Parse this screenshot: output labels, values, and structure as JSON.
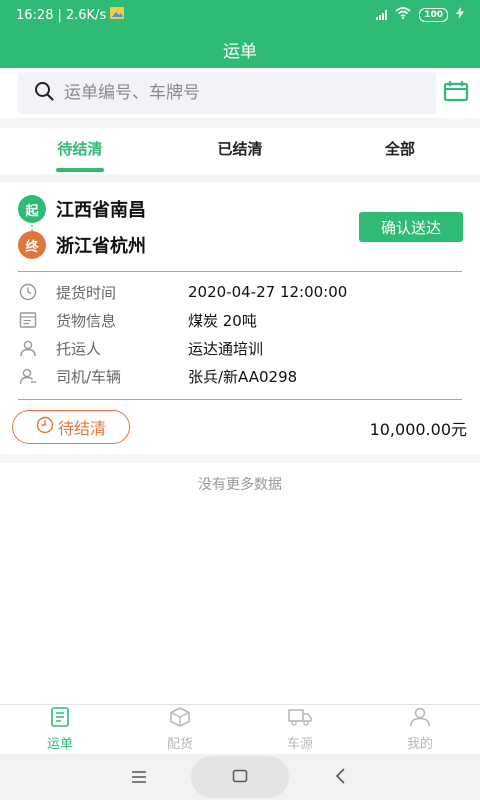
{
  "status_bar": {
    "time": "16:28",
    "speed": "2.6K/s",
    "battery": "100"
  },
  "header": {
    "title": "运单"
  },
  "search": {
    "placeholder": "运单编号、车牌号"
  },
  "tabs": [
    {
      "label": "待结清",
      "active": true
    },
    {
      "label": "已结清",
      "active": false
    },
    {
      "label": "全部",
      "active": false
    }
  ],
  "order": {
    "origin_badge": "起",
    "origin": "江西省南昌",
    "dest_badge": "终",
    "destination": "浙江省杭州",
    "confirm_label": "确认送达",
    "fields": [
      {
        "icon": "clock-icon",
        "label": "提货时间",
        "value": "2020-04-27 12:00:00"
      },
      {
        "icon": "document-icon",
        "label": "货物信息",
        "value": "煤炭 20吨"
      },
      {
        "icon": "person-icon",
        "label": "托运人",
        "value": "运达通培训"
      },
      {
        "icon": "driver-icon",
        "label": "司机/车辆",
        "value": "张兵/新AA0298"
      }
    ],
    "status": "待结清",
    "amount": "10,000.00元"
  },
  "footer_note": "没有更多数据",
  "bottom_nav": [
    {
      "label": "运单",
      "icon": "waybill-icon",
      "active": true
    },
    {
      "label": "配货",
      "icon": "box-icon",
      "active": false
    },
    {
      "label": "车源",
      "icon": "truck-icon",
      "active": false
    },
    {
      "label": "我的",
      "icon": "profile-icon",
      "active": false
    }
  ],
  "colors": {
    "primary": "#2fba76",
    "accent": "#e0763c"
  }
}
